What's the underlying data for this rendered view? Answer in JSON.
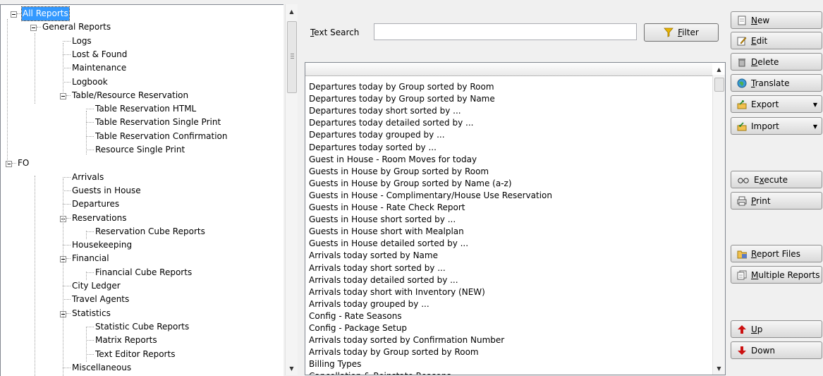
{
  "tree": {
    "nodes": [
      {
        "label": "All Reports",
        "level": 0,
        "expander": true,
        "selected": true
      },
      {
        "label": "General Reports",
        "level": 1,
        "expander": true
      },
      {
        "label": "Logs",
        "level": 2
      },
      {
        "label": "Lost & Found",
        "level": 2
      },
      {
        "label": "Maintenance",
        "level": 2
      },
      {
        "label": "Logbook",
        "level": 2
      },
      {
        "label": "Table/Resource Reservation",
        "level": 1,
        "expander": true
      },
      {
        "label": "Table Reservation HTML",
        "level": 2
      },
      {
        "label": "Table Reservation Single Print",
        "level": 2
      },
      {
        "label": "Table Reservation Confirmation",
        "level": 2
      },
      {
        "label": "Resource Single Print",
        "level": 2
      },
      {
        "label": "FO",
        "level": 0,
        "expander": true
      },
      {
        "label": "Arrivals",
        "level": 1
      },
      {
        "label": "Guests in House",
        "level": 1
      },
      {
        "label": "Departures",
        "level": 1
      },
      {
        "label": "Reservations",
        "level": 1,
        "expander": true
      },
      {
        "label": "Reservation Cube Reports",
        "level": 2
      },
      {
        "label": "Housekeeping",
        "level": 1
      },
      {
        "label": "Financial",
        "level": 1,
        "expander": true
      },
      {
        "label": "Financial Cube Reports",
        "level": 2
      },
      {
        "label": "City Ledger",
        "level": 1
      },
      {
        "label": "Travel Agents",
        "level": 1
      },
      {
        "label": "Statistics",
        "level": 1,
        "expander": true
      },
      {
        "label": "Statistic Cube Reports",
        "level": 2
      },
      {
        "label": "Matrix Reports",
        "level": 2
      },
      {
        "label": "Text Editor Reports",
        "level": 2
      },
      {
        "label": "Miscellaneous",
        "level": 1
      }
    ]
  },
  "search": {
    "label_prefix": "",
    "label_hotkey": "T",
    "label_rest": "ext Search",
    "value": "",
    "filter_hotkey": "F",
    "filter_rest": "ilter"
  },
  "reports": [
    "Departures today by Group sorted by Room",
    "Departures today by Group sorted by Name",
    "Departures today short sorted by ...",
    "Departures today detailed sorted by ...",
    "Departures today grouped by ...",
    "Departures today sorted by ...",
    "Guest in House - Room Moves for today",
    "Guests in House by Group sorted by Room",
    "Guests in House by Group sorted by Name (a-z)",
    "Guests in House - Complimentary/House Use Reservation",
    "Guests in House - Rate Check Report",
    "Guests in House short sorted by ...",
    "Guests in House short with Mealplan",
    "Guests in House detailed sorted by ...",
    "Arrivals today sorted by Name",
    "Arrivals today short sorted by ...",
    "Arrivals today detailed sorted by ...",
    "Arrivals today short with Inventory (NEW)",
    "Arrivals today grouped by ...",
    "Config - Rate Seasons",
    "Config - Package Setup",
    "Arrivals today sorted by Confirmation Number",
    "Arrivals today by Group sorted by Room",
    "Billing Types",
    "Cancellation & Reinstate Reasons"
  ],
  "buttons": [
    {
      "name": "new-button",
      "icon": "document-icon",
      "hotkey": "N",
      "rest": "ew",
      "dropdown": false
    },
    {
      "name": "edit-button",
      "icon": "edit-icon",
      "hotkey": "E",
      "rest": "dit",
      "dropdown": false
    },
    {
      "name": "delete-button",
      "icon": "trash-icon",
      "hotkey": "D",
      "rest": "elete",
      "dropdown": false
    },
    {
      "name": "translate-button",
      "icon": "globe-icon",
      "hotkey": "T",
      "rest": "ranslate",
      "dropdown": false
    },
    {
      "name": "export-button",
      "icon": "export-icon",
      "hotkey": "",
      "rest": "Export",
      "dropdown": true
    },
    {
      "name": "import-button",
      "icon": "import-icon",
      "hotkey": "",
      "rest": "Import",
      "dropdown": true
    },
    {
      "name": "execute-button",
      "icon": "glasses-icon",
      "hotkey": "",
      "rest": "Execute",
      "pre": "E",
      "mid": "x",
      "dropdown": false
    },
    {
      "name": "print-button",
      "icon": "printer-icon",
      "hotkey": "P",
      "rest": "rint",
      "dropdown": false
    },
    {
      "name": "report-files-button",
      "icon": "folder-icon",
      "hotkey": "R",
      "rest": "eport Files",
      "dropdown": false
    },
    {
      "name": "multiple-reports-button",
      "icon": "documents-icon",
      "hotkey": "M",
      "rest": "ultiple Reports",
      "dropdown": false
    },
    {
      "name": "up-button",
      "icon": "arrow-up-icon",
      "hotkey": "U",
      "rest": "p",
      "dropdown": false
    },
    {
      "name": "down-button",
      "icon": "arrow-down-icon",
      "hotkey": "",
      "rest": "Down",
      "dropdown": false
    }
  ],
  "colors": {
    "selection": "#3399ff",
    "arrow_red": "#cc1111"
  }
}
